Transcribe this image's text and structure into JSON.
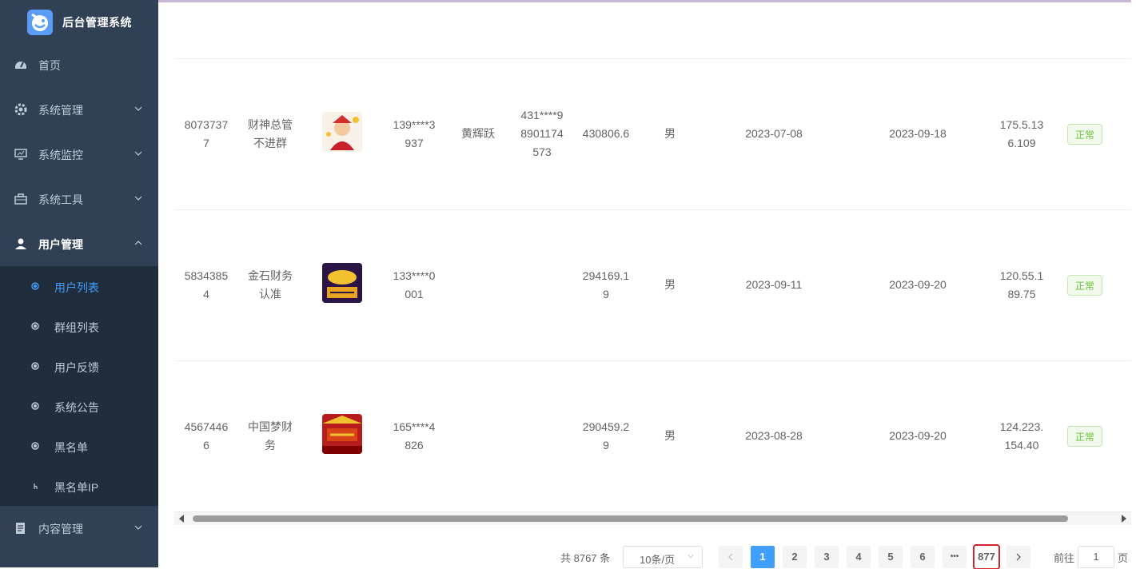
{
  "app": {
    "title": "后台管理系统"
  },
  "sidebar": {
    "items": [
      {
        "label": "首页",
        "icon": "dashboard-icon"
      },
      {
        "label": "系统管理",
        "icon": "gear-icon"
      },
      {
        "label": "系统监控",
        "icon": "monitor-icon"
      },
      {
        "label": "系统工具",
        "icon": "toolbox-icon"
      },
      {
        "label": "用户管理",
        "icon": "user-icon"
      },
      {
        "label": "内容管理",
        "icon": "document-icon"
      }
    ],
    "subitems": [
      {
        "label": "用户列表"
      },
      {
        "label": "群组列表"
      },
      {
        "label": "用户反馈"
      },
      {
        "label": "系统公告"
      },
      {
        "label": "黑名单"
      },
      {
        "label": "黑名单IP"
      }
    ]
  },
  "table": {
    "rows": [
      {
        "id": [
          "8073737",
          "7"
        ],
        "name": [
          "财神总管",
          "不进群"
        ],
        "phone": [
          "139****3",
          "937"
        ],
        "realname": "黄辉跃",
        "idcard": [
          "431****9",
          "8901174",
          "573"
        ],
        "balance": [
          "430806.6"
        ],
        "gender": "男",
        "created": "2023-07-08",
        "last_login": "2023-09-18",
        "ip": [
          "175.5.13",
          "6.109"
        ],
        "status": "正常"
      },
      {
        "id": [
          "5834385",
          "4"
        ],
        "name": [
          "金石财务",
          "认准"
        ],
        "phone": [
          "133****0",
          "001"
        ],
        "realname": "",
        "idcard": [],
        "balance": [
          "294169.1",
          "9"
        ],
        "gender": "男",
        "created": "2023-09-11",
        "last_login": "2023-09-20",
        "ip": [
          "120.55.1",
          "89.75"
        ],
        "status": "正常"
      },
      {
        "id": [
          "4567446",
          "6"
        ],
        "name": [
          "中国梦财",
          "务"
        ],
        "phone": [
          "165****4",
          "826"
        ],
        "realname": "",
        "idcard": [],
        "balance": [
          "290459.2",
          "9"
        ],
        "gender": "男",
        "created": "2023-08-28",
        "last_login": "2023-09-20",
        "ip": [
          "124.223.",
          "154.40"
        ],
        "status": "正常"
      }
    ],
    "colors": {
      "status_green": "#67c23a",
      "accent": "#409eff"
    }
  },
  "pagination": {
    "total_label": "共 8767 条",
    "page_size_label": "10条/页",
    "pages": [
      "1",
      "2",
      "3",
      "4",
      "5",
      "6"
    ],
    "ellipsis": "•••",
    "last_page": "877",
    "current_page": "1",
    "goto_prefix": "前往",
    "goto_value": "1",
    "goto_suffix": "页"
  }
}
